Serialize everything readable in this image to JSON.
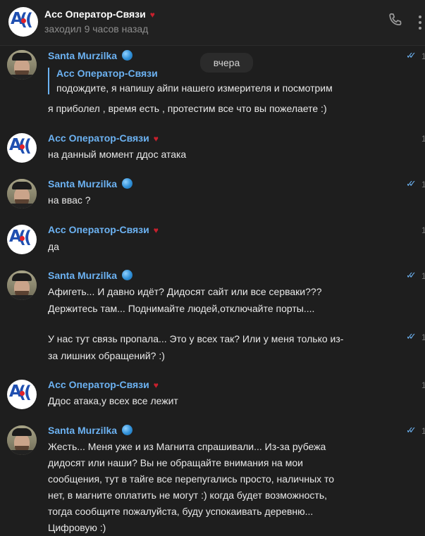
{
  "header": {
    "title": "Acc Оператор-Связи",
    "title_emoji": "devil",
    "status": "заходил 9 часов назад",
    "phone_icon": "phone-icon",
    "more_icon": "more-vertical-icon"
  },
  "date_divider": "вчера",
  "messages": [
    {
      "sender": "Santa Murzilka",
      "badge": "globe",
      "reply_to": {
        "name": "Acc Оператор-Связи",
        "text": "подождите, я напишу айпи нашего измерителя и посмотрим"
      },
      "lines": [
        "я приболел , время есть , протестим все что вы пожелаете :)"
      ],
      "read": true
    },
    {
      "sender": "Acc Оператор-Связи",
      "badge": "devil",
      "lines": [
        "на данный момент ддос атака"
      ],
      "read": false
    },
    {
      "sender": "Santa Murzilka",
      "badge": "globe",
      "lines": [
        "на ввас ?"
      ],
      "read": true
    },
    {
      "sender": "Acc Оператор-Связи",
      "badge": "devil",
      "lines": [
        "да"
      ],
      "read": false
    },
    {
      "sender": "Santa Murzilka",
      "badge": "globe",
      "lines": [
        "Афигеть... И давно идёт? Дидосят сайт или все серваки???",
        "Держитесь там... Поднимайте людей,отключайте порты...."
      ],
      "read": true
    },
    {
      "sender": "Santa Murzilka",
      "badge": "globe",
      "continuation": true,
      "lines": [
        "У нас тут связь пропала... Это у всех так? Или у меня только из-",
        "за лишних обращений? :)"
      ],
      "read": true
    },
    {
      "sender": "Acc Оператор-Связи",
      "badge": "devil",
      "lines": [
        "Ддос атака,у всех все лежит"
      ],
      "read": false
    },
    {
      "sender": "Santa Murzilka",
      "badge": "globe",
      "lines": [
        "Жесть... Меня уже и из Магнита спрашивали... Из-за рубежа",
        "дидосят или наши? Вы не обращайте внимания на мои",
        "сообщения, тут в тайге все перепугались просто, наличных то",
        "нет,  в магните оплатить не могут :) когда будет возможность,",
        "тогда сообщите пожалуйста, буду успокаивать деревню...",
        "Цифровую :)"
      ],
      "read": true
    }
  ],
  "edge_time_glyph": "1",
  "colors": {
    "background": "#1e1e1e",
    "header": "#212121",
    "name_accent": "#6cb2f2",
    "text": "#e8e8e8",
    "muted": "#8d8d8d"
  }
}
